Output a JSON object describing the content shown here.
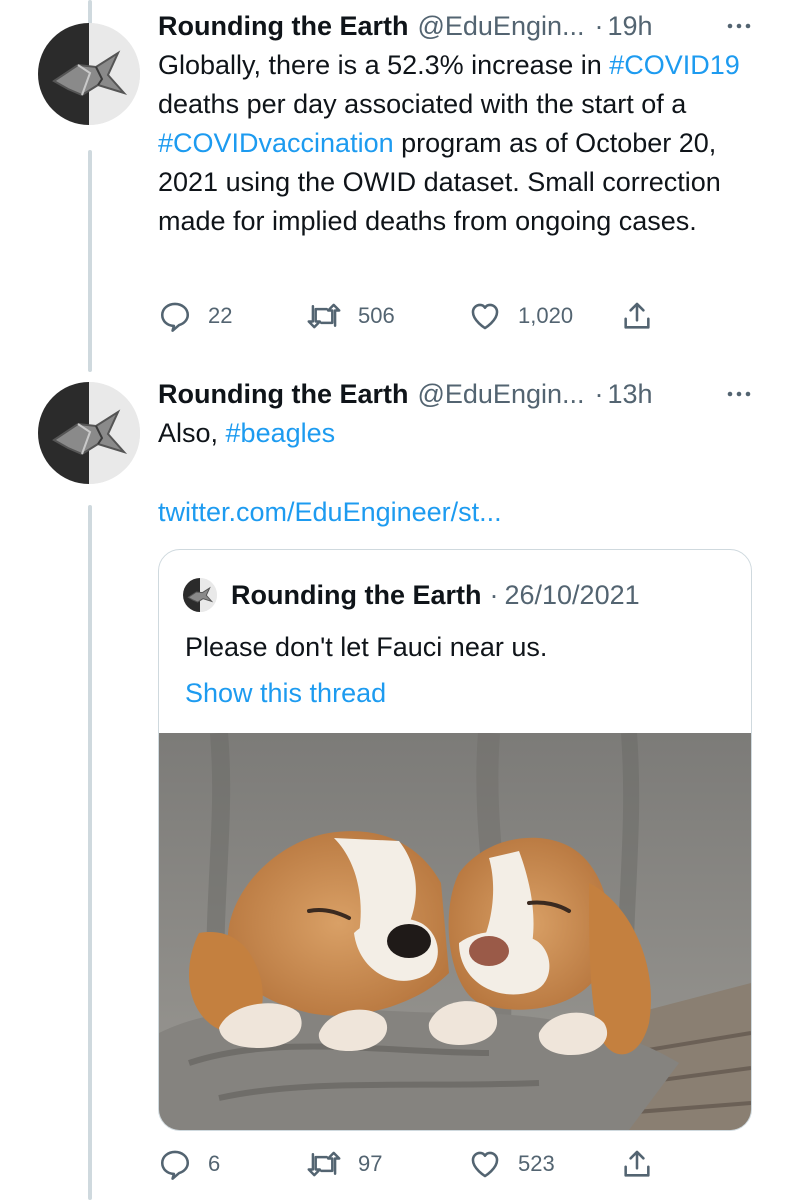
{
  "tweets": [
    {
      "name": "Rounding the Earth",
      "handle": "@EduEngin...",
      "dot": "·",
      "time": "19h",
      "more_icon": "ellipsis-icon",
      "text_parts": [
        {
          "type": "text",
          "value": "Globally, there is a 52.3% increase in "
        },
        {
          "type": "tag",
          "value": "#COVID19"
        },
        {
          "type": "text",
          "value": " deaths per day associated with the start of a "
        },
        {
          "type": "tag",
          "value": "#COVIDvaccination"
        },
        {
          "type": "text",
          "value": " program as of October 20, 2021 using the OWID dataset. Small correction made for implied deaths from ongoing cases."
        }
      ],
      "replies": "22",
      "retweets": "506",
      "likes": "1,020"
    },
    {
      "name": "Rounding the Earth",
      "handle": "@EduEngin...",
      "dot": "·",
      "time": "13h",
      "more_icon": "ellipsis-icon",
      "text_prefix": "Also, ",
      "text_tag": "#beagles",
      "link": "twitter.com/EduEngineer/st...",
      "quoted": {
        "name": "Rounding the Earth",
        "dot": "·",
        "date": "26/10/2021",
        "text": "Please don't let Fauci near us.",
        "show_thread": "Show this thread",
        "photo_icon": "sleeping-beagle-puppies-photo"
      },
      "replies": "6",
      "retweets": "97",
      "likes": "523"
    }
  ],
  "colors": {
    "link": "#1d9bf0",
    "muted": "#536471",
    "text": "#0f1419",
    "thread_line": "#cfd9de"
  },
  "icons": {
    "reply": "reply-icon",
    "retweet": "retweet-icon",
    "like": "heart-icon",
    "share": "share-icon"
  }
}
